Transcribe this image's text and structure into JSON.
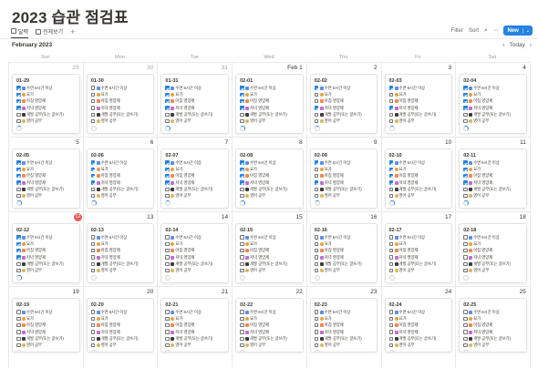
{
  "page": {
    "title": "2023 습관 점검표"
  },
  "views": {
    "tab1": "달력",
    "tab2": "전체보기"
  },
  "toolbar": {
    "filter": "Filter",
    "sort": "Sort",
    "new_label": "New"
  },
  "calendar": {
    "month_label": "February 2023",
    "today_label": "Today",
    "weekdays": [
      "Sun",
      "Mon",
      "Tue",
      "Wed",
      "Thu",
      "Fri",
      "Sat"
    ],
    "habits": [
      "수면 6시간 이상",
      "요가",
      "아침 영양제",
      "저녁 영양제",
      "개발 공부(또는 글쓰기)",
      "영어 공부"
    ],
    "habit_icons": [
      "moon-icon",
      "yoga-icon",
      "sunrise-pill-icon",
      "sunset-pill-icon",
      "laptop-icon",
      "book-icon"
    ],
    "colors": {
      "accent": "#2383e2",
      "today": "#eb5757"
    },
    "weeks": [
      {
        "days": [
          {
            "daynum": "29",
            "muted": true,
            "card": "01-29",
            "checks": [
              1,
              1,
              1,
              1,
              0,
              0
            ],
            "progress": 1
          },
          {
            "daynum": "30",
            "muted": true,
            "card": "01-30",
            "checks": [
              0,
              0,
              0,
              0,
              0,
              0
            ],
            "progress": 0
          },
          {
            "daynum": "31",
            "muted": true,
            "card": "01-31",
            "checks": [
              1,
              1,
              1,
              1,
              0,
              0
            ],
            "progress": 2
          },
          {
            "daynum": "Feb 1",
            "card": "02-01",
            "checks": [
              1,
              1,
              1,
              1,
              0,
              0
            ],
            "progress": 2
          },
          {
            "daynum": "2",
            "card": "02-02",
            "checks": [
              1,
              0,
              0,
              1,
              0,
              0
            ],
            "progress": 1
          },
          {
            "daynum": "3",
            "card": "02-03",
            "checks": [
              1,
              0,
              0,
              1,
              0,
              0
            ],
            "progress": 1
          },
          {
            "daynum": "4",
            "card": "02-04",
            "checks": [
              1,
              1,
              1,
              1,
              0,
              0
            ],
            "progress": 2
          }
        ]
      },
      {
        "days": [
          {
            "daynum": "5",
            "card": "02-05",
            "checks": [
              1,
              1,
              1,
              1,
              0,
              0
            ],
            "progress": 2
          },
          {
            "daynum": "6",
            "card": "02-06",
            "checks": [
              1,
              1,
              1,
              1,
              0,
              0
            ],
            "progress": 2
          },
          {
            "daynum": "7",
            "card": "02-07",
            "checks": [
              1,
              1,
              1,
              1,
              0,
              0
            ],
            "progress": 1
          },
          {
            "daynum": "8",
            "card": "02-08",
            "checks": [
              1,
              1,
              1,
              1,
              0,
              0
            ],
            "progress": 2
          },
          {
            "daynum": "9",
            "card": "02-09",
            "checks": [
              1,
              0,
              0,
              1,
              0,
              0
            ],
            "progress": 1
          },
          {
            "daynum": "10",
            "card": "02-10",
            "checks": [
              1,
              1,
              1,
              1,
              0,
              0
            ],
            "progress": 2
          },
          {
            "daynum": "11",
            "card": "02-11",
            "checks": [
              1,
              1,
              1,
              1,
              0,
              0
            ],
            "progress": 2
          }
        ]
      },
      {
        "days": [
          {
            "daynum": "12",
            "today": true,
            "card": "02-12",
            "checks": [
              1,
              1,
              1,
              1,
              0,
              0
            ],
            "progress": 2
          },
          {
            "daynum": "13",
            "card": "02-13",
            "checks": [
              0,
              0,
              0,
              0,
              0,
              0
            ],
            "progress": 0
          },
          {
            "daynum": "14",
            "card": "02-14",
            "checks": [
              0,
              0,
              0,
              0,
              0,
              0
            ],
            "progress": 0
          },
          {
            "daynum": "15",
            "card": "02-15",
            "checks": [
              0,
              0,
              0,
              0,
              0,
              0
            ],
            "progress": 0
          },
          {
            "daynum": "16",
            "card": "02-16",
            "checks": [
              0,
              0,
              0,
              0,
              0,
              0
            ],
            "progress": 0
          },
          {
            "daynum": "17",
            "card": "02-17",
            "checks": [
              0,
              0,
              0,
              0,
              0,
              0
            ],
            "progress": 0
          },
          {
            "daynum": "18",
            "card": "02-18",
            "checks": [
              0,
              0,
              0,
              0,
              0,
              0
            ],
            "progress": 0
          }
        ]
      },
      {
        "days": [
          {
            "daynum": "19",
            "card": "02-19",
            "checks": [
              0,
              0,
              0,
              0,
              0,
              0
            ],
            "progress": 0
          },
          {
            "daynum": "20",
            "card": "02-20",
            "checks": [
              0,
              0,
              0,
              0,
              0,
              0
            ],
            "progress": 0
          },
          {
            "daynum": "21",
            "card": "02-21",
            "checks": [
              0,
              0,
              0,
              0,
              0,
              0
            ],
            "progress": 0
          },
          {
            "daynum": "22",
            "card": "02-22",
            "checks": [
              0,
              0,
              0,
              0,
              0,
              0
            ],
            "progress": 0
          },
          {
            "daynum": "23",
            "card": "02-23",
            "checks": [
              0,
              0,
              0,
              0,
              0,
              0
            ],
            "progress": 0
          },
          {
            "daynum": "24",
            "card": "02-24",
            "checks": [
              0,
              0,
              0,
              0,
              0,
              0
            ],
            "progress": 0
          },
          {
            "daynum": "25",
            "card": "02-25",
            "checks": [
              0,
              0,
              0,
              0,
              0,
              0
            ],
            "progress": 0
          }
        ]
      }
    ]
  }
}
